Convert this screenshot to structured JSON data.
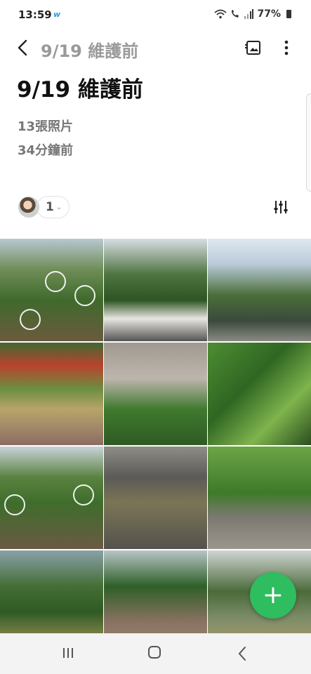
{
  "status_bar": {
    "time": "13:59",
    "app_icon": "w-app-icon",
    "battery_percent": "77%"
  },
  "appbar": {
    "title": "9/19 維護前"
  },
  "album": {
    "title": "9/19 維護前",
    "photo_count": "13張照片",
    "updated": "34分鐘前"
  },
  "share": {
    "member_count": "1"
  },
  "grid": {
    "tiles": [
      {
        "name": "photo-garden-circles-1",
        "circles": true
      },
      {
        "name": "photo-tree-house",
        "circles": false
      },
      {
        "name": "photo-tall-tree-sky",
        "circles": false
      },
      {
        "name": "photo-brick-path-red-flowers",
        "circles": false
      },
      {
        "name": "photo-wall-plants",
        "circles": false
      },
      {
        "name": "photo-leafy-bush",
        "circles": false
      },
      {
        "name": "photo-garden-circles-2",
        "circles": true
      },
      {
        "name": "photo-parking-lot",
        "circles": false
      },
      {
        "name": "photo-shrub-pillar",
        "circles": false
      },
      {
        "name": "photo-lawn-trees",
        "circles": false
      },
      {
        "name": "photo-bonsai-path",
        "circles": false
      },
      {
        "name": "photo-yard-shed",
        "circles": false
      }
    ]
  },
  "colors": {
    "fab": "#2ebd5f",
    "title": "#111111",
    "muted": "#777777"
  }
}
